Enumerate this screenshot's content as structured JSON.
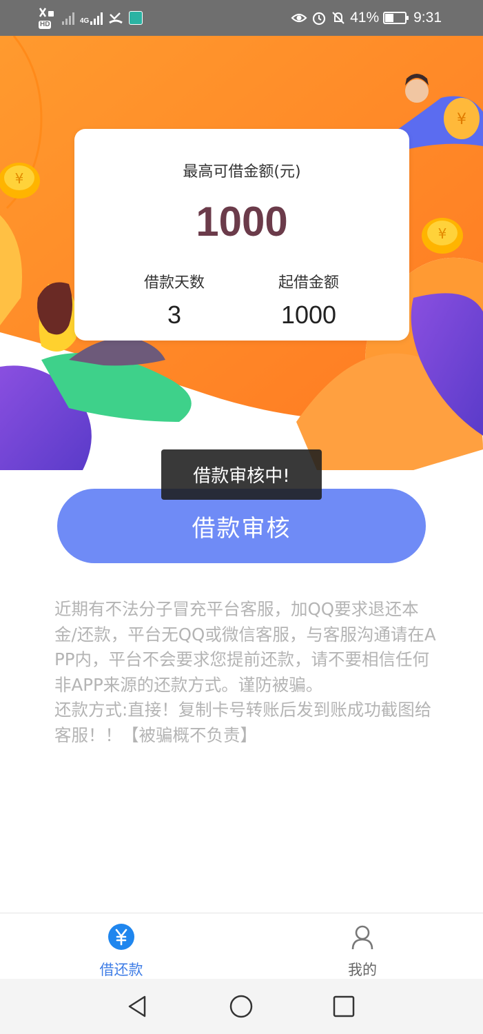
{
  "status_bar": {
    "battery": "41%",
    "battery_level": 0.41,
    "time": "9:31",
    "network": "4G",
    "hd_badge": "HD",
    "icons": [
      "wifi-calling-icon",
      "signal-icon",
      "signal-4g-icon",
      "missed-call-icon",
      "app-notification-icon",
      "eye-icon",
      "alarm-icon",
      "mute-icon",
      "battery-icon"
    ]
  },
  "card": {
    "title": "最高可借金额(元)",
    "amount": "1000",
    "days_label": "借款天数",
    "days_value": "3",
    "min_label": "起借金额",
    "min_value": "1000"
  },
  "toast": "借款审核中!",
  "primary_button": "借款审核",
  "notice": {
    "line1": "近期有不法分子冒充平台客服，加QQ要求退还本金/还款，平台无QQ或微信客服，与客服沟通请在APP内，平台不会要求您提前还款，请不要相信任何非APP来源的还款方式。谨防被骗。",
    "line2": "还款方式:直接！复制卡号转账后发到账成功截图给客服！！【被骗概不负责】"
  },
  "tabs": [
    {
      "label": "借还款",
      "icon": "yuan-icon",
      "active": true
    },
    {
      "label": "我的",
      "icon": "user-icon",
      "active": false
    }
  ],
  "colors": {
    "accent_blue": "#3f7de6",
    "button_blue": "#6f8bf6",
    "hero_orange": "#ff8a26",
    "amount_color": "#6b3b4a"
  }
}
